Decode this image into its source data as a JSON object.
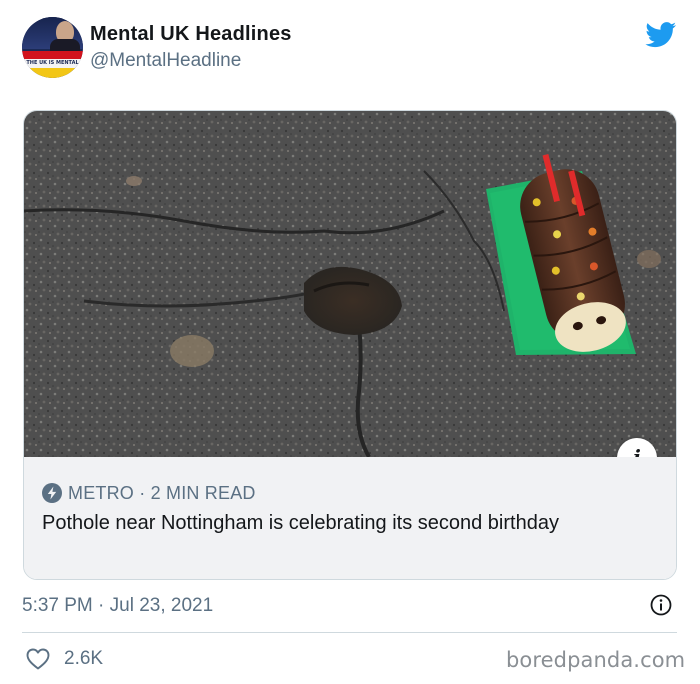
{
  "account": {
    "display_name": "Mental UK Headlines",
    "handle": "@MentalHeadline",
    "avatar_caption": "THE UK IS MENTAL",
    "avatar_icon": "profile-photo-news-graphic"
  },
  "brand": {
    "logo_icon": "twitter-bird-icon",
    "accent_color": "#1d9bf0"
  },
  "card": {
    "image_description_icon": "info-badge-icon",
    "source_icon": "lightning-bolt-icon",
    "source": "METRO · 2 MIN READ",
    "title": "Pothole near Nottingham is celebrating its second birthday"
  },
  "meta": {
    "timestamp": "5:37 PM · Jul 23, 2021",
    "info_icon": "info-circle-icon"
  },
  "engagement": {
    "like_icon": "heart-icon",
    "like_count": "2.6K"
  },
  "watermark": "boredpanda.com"
}
